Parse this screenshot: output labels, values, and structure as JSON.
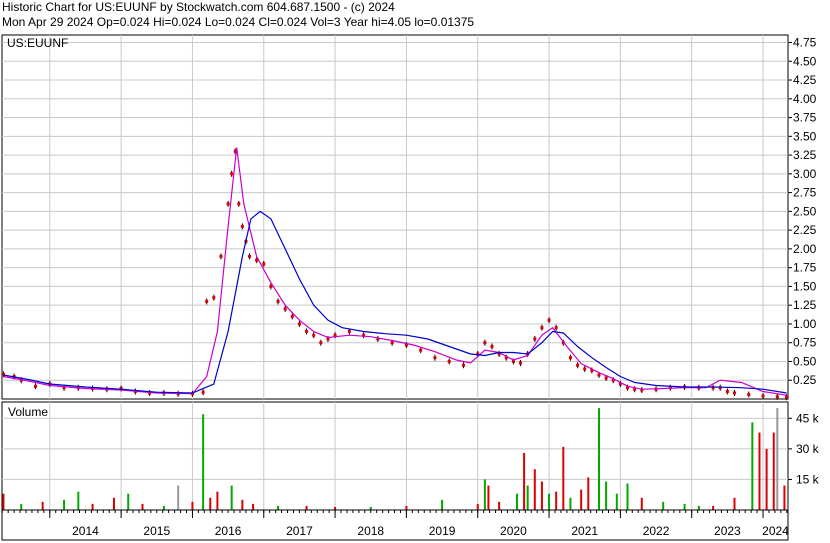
{
  "header": {
    "line1": "Historic Chart for US:EUUNF by Stockwatch.com 604.687.1500 - (c) 2024",
    "line2": "Mon Apr 29 2024   Op=0.024  Hi=0.024  Lo=0.024  Cl=0.024  Vol=3  Year hi=4.05  lo=0.01375"
  },
  "chart_data": [
    {
      "type": "line",
      "label": "US:EUUNF",
      "y_ticks": [
        "0.25",
        "0.50",
        "0.75",
        "1.00",
        "1.25",
        "1.50",
        "1.75",
        "2.00",
        "2.25",
        "2.50",
        "2.75",
        "3.00",
        "3.25",
        "3.50",
        "3.75",
        "4.00",
        "4.25",
        "4.50",
        "4.75"
      ],
      "ylim": [
        0,
        4.85
      ],
      "x_ticks": [
        "2014",
        "2015",
        "2016",
        "2017",
        "2018",
        "2019",
        "2020",
        "2021",
        "2022",
        "2023",
        "2024"
      ],
      "xlim": [
        2013.33,
        2024.35
      ],
      "grid": true,
      "series": [
        {
          "style": "price-bars",
          "color": "#dd0000",
          "points": [
            [
              2013.35,
              0.33
            ],
            [
              2013.5,
              0.3
            ],
            [
              2013.6,
              0.25
            ],
            [
              2013.8,
              0.17
            ],
            [
              2014.0,
              0.2
            ],
            [
              2014.2,
              0.15
            ],
            [
              2014.4,
              0.15
            ],
            [
              2014.6,
              0.14
            ],
            [
              2014.8,
              0.13
            ],
            [
              2015.0,
              0.14
            ],
            [
              2015.2,
              0.1
            ],
            [
              2015.4,
              0.08
            ],
            [
              2015.6,
              0.08
            ],
            [
              2015.8,
              0.07
            ],
            [
              2016.0,
              0.07
            ],
            [
              2016.15,
              0.09
            ],
            [
              2016.2,
              1.3
            ],
            [
              2016.3,
              1.35
            ],
            [
              2016.4,
              1.9
            ],
            [
              2016.5,
              2.6
            ],
            [
              2016.55,
              3.0
            ],
            [
              2016.6,
              3.3
            ],
            [
              2016.65,
              2.6
            ],
            [
              2016.7,
              2.3
            ],
            [
              2016.75,
              2.1
            ],
            [
              2016.8,
              1.9
            ],
            [
              2016.9,
              1.85
            ],
            [
              2017.0,
              1.8
            ],
            [
              2017.1,
              1.5
            ],
            [
              2017.2,
              1.3
            ],
            [
              2017.3,
              1.2
            ],
            [
              2017.4,
              1.1
            ],
            [
              2017.5,
              1.0
            ],
            [
              2017.6,
              0.9
            ],
            [
              2017.7,
              0.85
            ],
            [
              2017.8,
              0.75
            ],
            [
              2017.9,
              0.8
            ],
            [
              2018.0,
              0.85
            ],
            [
              2018.2,
              0.9
            ],
            [
              2018.4,
              0.85
            ],
            [
              2018.6,
              0.8
            ],
            [
              2018.8,
              0.75
            ],
            [
              2019.0,
              0.72
            ],
            [
              2019.2,
              0.65
            ],
            [
              2019.4,
              0.55
            ],
            [
              2019.6,
              0.5
            ],
            [
              2019.8,
              0.45
            ],
            [
              2020.0,
              0.6
            ],
            [
              2020.1,
              0.75
            ],
            [
              2020.2,
              0.7
            ],
            [
              2020.3,
              0.6
            ],
            [
              2020.4,
              0.55
            ],
            [
              2020.5,
              0.5
            ],
            [
              2020.6,
              0.48
            ],
            [
              2020.7,
              0.6
            ],
            [
              2020.8,
              0.8
            ],
            [
              2020.9,
              0.95
            ],
            [
              2021.0,
              1.05
            ],
            [
              2021.1,
              0.95
            ],
            [
              2021.2,
              0.75
            ],
            [
              2021.3,
              0.55
            ],
            [
              2021.4,
              0.45
            ],
            [
              2021.5,
              0.4
            ],
            [
              2021.6,
              0.38
            ],
            [
              2021.7,
              0.32
            ],
            [
              2021.8,
              0.28
            ],
            [
              2021.9,
              0.25
            ],
            [
              2022.0,
              0.2
            ],
            [
              2022.1,
              0.15
            ],
            [
              2022.2,
              0.13
            ],
            [
              2022.3,
              0.12
            ],
            [
              2022.5,
              0.13
            ],
            [
              2022.7,
              0.15
            ],
            [
              2022.9,
              0.16
            ],
            [
              2023.1,
              0.15
            ],
            [
              2023.3,
              0.15
            ],
            [
              2023.4,
              0.15
            ],
            [
              2023.5,
              0.1
            ],
            [
              2023.6,
              0.08
            ],
            [
              2023.8,
              0.06
            ],
            [
              2024.0,
              0.04
            ],
            [
              2024.2,
              0.03
            ],
            [
              2024.33,
              0.024
            ]
          ]
        },
        {
          "style": "moving-average",
          "color": "#cc00cc",
          "points": [
            [
              2013.35,
              0.3
            ],
            [
              2013.7,
              0.24
            ],
            [
              2014.0,
              0.18
            ],
            [
              2014.5,
              0.14
            ],
            [
              2015.0,
              0.12
            ],
            [
              2015.5,
              0.08
            ],
            [
              2016.0,
              0.07
            ],
            [
              2016.2,
              0.3
            ],
            [
              2016.35,
              0.9
            ],
            [
              2016.5,
              2.3
            ],
            [
              2016.62,
              3.35
            ],
            [
              2016.72,
              2.6
            ],
            [
              2016.9,
              1.9
            ],
            [
              2017.1,
              1.55
            ],
            [
              2017.3,
              1.25
            ],
            [
              2017.5,
              1.05
            ],
            [
              2017.7,
              0.9
            ],
            [
              2017.9,
              0.82
            ],
            [
              2018.2,
              0.85
            ],
            [
              2018.5,
              0.83
            ],
            [
              2018.8,
              0.78
            ],
            [
              2019.1,
              0.72
            ],
            [
              2019.4,
              0.63
            ],
            [
              2019.7,
              0.52
            ],
            [
              2019.9,
              0.48
            ],
            [
              2020.1,
              0.65
            ],
            [
              2020.3,
              0.62
            ],
            [
              2020.5,
              0.52
            ],
            [
              2020.7,
              0.58
            ],
            [
              2020.9,
              0.85
            ],
            [
              2021.05,
              0.95
            ],
            [
              2021.25,
              0.7
            ],
            [
              2021.45,
              0.47
            ],
            [
              2021.7,
              0.35
            ],
            [
              2021.9,
              0.27
            ],
            [
              2022.1,
              0.17
            ],
            [
              2022.3,
              0.13
            ],
            [
              2022.6,
              0.14
            ],
            [
              2022.9,
              0.15
            ],
            [
              2023.2,
              0.15
            ],
            [
              2023.4,
              0.25
            ],
            [
              2023.7,
              0.22
            ],
            [
              2024.0,
              0.1
            ],
            [
              2024.33,
              0.05
            ]
          ]
        },
        {
          "style": "moving-average",
          "color": "#0000cc",
          "points": [
            [
              2013.35,
              0.32
            ],
            [
              2013.7,
              0.26
            ],
            [
              2014.0,
              0.2
            ],
            [
              2014.5,
              0.16
            ],
            [
              2015.0,
              0.13
            ],
            [
              2015.5,
              0.09
            ],
            [
              2016.0,
              0.08
            ],
            [
              2016.3,
              0.2
            ],
            [
              2016.5,
              0.9
            ],
            [
              2016.7,
              1.9
            ],
            [
              2016.82,
              2.4
            ],
            [
              2016.95,
              2.5
            ],
            [
              2017.1,
              2.4
            ],
            [
              2017.3,
              2.0
            ],
            [
              2017.5,
              1.6
            ],
            [
              2017.7,
              1.25
            ],
            [
              2017.9,
              1.05
            ],
            [
              2018.1,
              0.95
            ],
            [
              2018.4,
              0.9
            ],
            [
              2018.7,
              0.87
            ],
            [
              2019.0,
              0.85
            ],
            [
              2019.3,
              0.8
            ],
            [
              2019.6,
              0.7
            ],
            [
              2019.9,
              0.6
            ],
            [
              2020.1,
              0.58
            ],
            [
              2020.3,
              0.62
            ],
            [
              2020.5,
              0.62
            ],
            [
              2020.7,
              0.6
            ],
            [
              2020.9,
              0.75
            ],
            [
              2021.05,
              0.9
            ],
            [
              2021.2,
              0.88
            ],
            [
              2021.4,
              0.7
            ],
            [
              2021.6,
              0.55
            ],
            [
              2021.8,
              0.42
            ],
            [
              2022.0,
              0.3
            ],
            [
              2022.2,
              0.22
            ],
            [
              2022.5,
              0.18
            ],
            [
              2022.9,
              0.16
            ],
            [
              2023.3,
              0.16
            ],
            [
              2023.7,
              0.15
            ],
            [
              2024.0,
              0.13
            ],
            [
              2024.33,
              0.08
            ]
          ]
        }
      ]
    },
    {
      "type": "bar",
      "label": "Volume",
      "y_ticks": [
        "15 k",
        "30 k",
        "45 k"
      ],
      "ylim": [
        0,
        53000
      ],
      "x_ticks": [
        "2014",
        "2015",
        "2016",
        "2017",
        "2018",
        "2019",
        "2020",
        "2021",
        "2022",
        "2023",
        "2024"
      ],
      "xlim": [
        2013.33,
        2024.35
      ],
      "grid": true,
      "bars": [
        [
          2013.35,
          8000,
          "#dd0000"
        ],
        [
          2013.6,
          3000,
          "#00aa00"
        ],
        [
          2013.9,
          4000,
          "#dd0000"
        ],
        [
          2014.2,
          5000,
          "#00aa00"
        ],
        [
          2014.4,
          9000,
          "#00aa00"
        ],
        [
          2014.6,
          3000,
          "#dd0000"
        ],
        [
          2014.9,
          6000,
          "#dd0000"
        ],
        [
          2015.1,
          8000,
          "#00aa00"
        ],
        [
          2015.3,
          3000,
          "#dd0000"
        ],
        [
          2015.6,
          2000,
          "#00aa00"
        ],
        [
          2015.8,
          12000,
          "#999999"
        ],
        [
          2016.0,
          4000,
          "#dd0000"
        ],
        [
          2016.15,
          47000,
          "#00aa00"
        ],
        [
          2016.25,
          6000,
          "#dd0000"
        ],
        [
          2016.35,
          9000,
          "#dd0000"
        ],
        [
          2016.55,
          12000,
          "#00aa00"
        ],
        [
          2016.7,
          5000,
          "#dd0000"
        ],
        [
          2016.85,
          3000,
          "#dd0000"
        ],
        [
          2017.2,
          2000,
          "#00aa00"
        ],
        [
          2017.6,
          2000,
          "#dd0000"
        ],
        [
          2018.0,
          1500,
          "#dd0000"
        ],
        [
          2018.5,
          1500,
          "#00aa00"
        ],
        [
          2019.0,
          2000,
          "#dd0000"
        ],
        [
          2019.5,
          5000,
          "#00aa00"
        ],
        [
          2020.0,
          3000,
          "#dd0000"
        ],
        [
          2020.1,
          15000,
          "#00aa00"
        ],
        [
          2020.15,
          12000,
          "#dd0000"
        ],
        [
          2020.3,
          4000,
          "#dd0000"
        ],
        [
          2020.55,
          8000,
          "#00aa00"
        ],
        [
          2020.65,
          28000,
          "#dd0000"
        ],
        [
          2020.7,
          12000,
          "#00aa00"
        ],
        [
          2020.8,
          20000,
          "#dd0000"
        ],
        [
          2020.9,
          14000,
          "#dd0000"
        ],
        [
          2021.0,
          8000,
          "#00aa00"
        ],
        [
          2021.1,
          9000,
          "#dd0000"
        ],
        [
          2021.2,
          31000,
          "#dd0000"
        ],
        [
          2021.3,
          6000,
          "#00aa00"
        ],
        [
          2021.45,
          10000,
          "#dd0000"
        ],
        [
          2021.55,
          16000,
          "#dd0000"
        ],
        [
          2021.7,
          50000,
          "#00aa00"
        ],
        [
          2021.8,
          14000,
          "#00aa00"
        ],
        [
          2021.95,
          8000,
          "#00aa00"
        ],
        [
          2022.1,
          13000,
          "#00aa00"
        ],
        [
          2022.3,
          6000,
          "#dd0000"
        ],
        [
          2022.6,
          4000,
          "#00aa00"
        ],
        [
          2022.9,
          3000,
          "#00aa00"
        ],
        [
          2023.1,
          2000,
          "#00aa00"
        ],
        [
          2023.3,
          2000,
          "#dd0000"
        ],
        [
          2023.6,
          6000,
          "#dd0000"
        ],
        [
          2023.85,
          43000,
          "#00aa00"
        ],
        [
          2023.95,
          38000,
          "#dd0000"
        ],
        [
          2024.05,
          30000,
          "#dd0000"
        ],
        [
          2024.15,
          38000,
          "#dd0000"
        ],
        [
          2024.2,
          50000,
          "#999999"
        ],
        [
          2024.3,
          12000,
          "#dd0000"
        ]
      ]
    }
  ],
  "labels": {
    "price_panel": "US:EUUNF",
    "volume_panel": "Volume"
  }
}
